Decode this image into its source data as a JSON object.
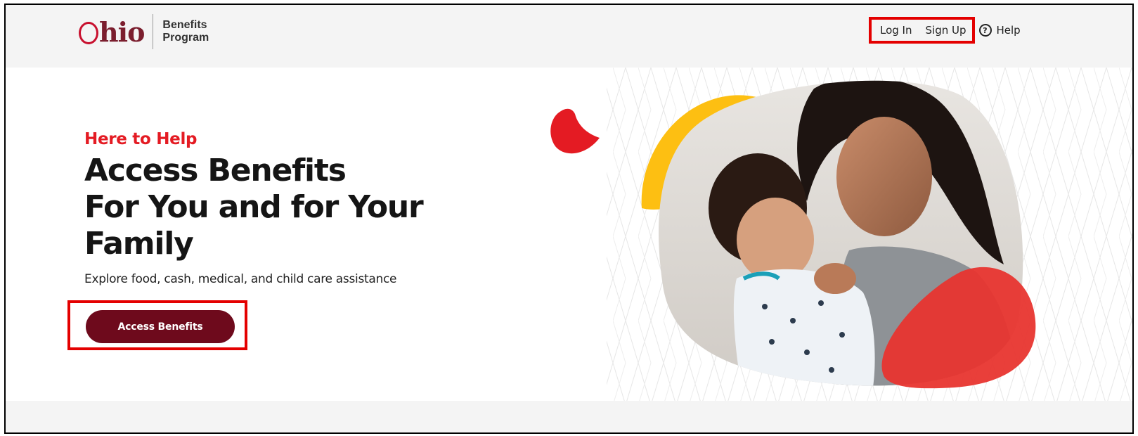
{
  "header": {
    "logo": {
      "wordmark": "Ohio",
      "line1": "Benefits",
      "line2": "Program"
    },
    "nav": {
      "login_label": "Log In",
      "signup_label": "Sign Up",
      "help_label": "Help"
    }
  },
  "hero": {
    "eyebrow": "Here to Help",
    "headline": [
      "Access Benefits",
      "For You and for Your",
      "Family"
    ],
    "subtext": "Explore food, cash, medical, and child care assistance",
    "cta_label": "Access Benefits"
  },
  "colors": {
    "brand_maroon": "#6e0a1c",
    "accent_red": "#e41b23",
    "accent_yellow": "#fdbf12",
    "highlight_box": "#e40000"
  }
}
